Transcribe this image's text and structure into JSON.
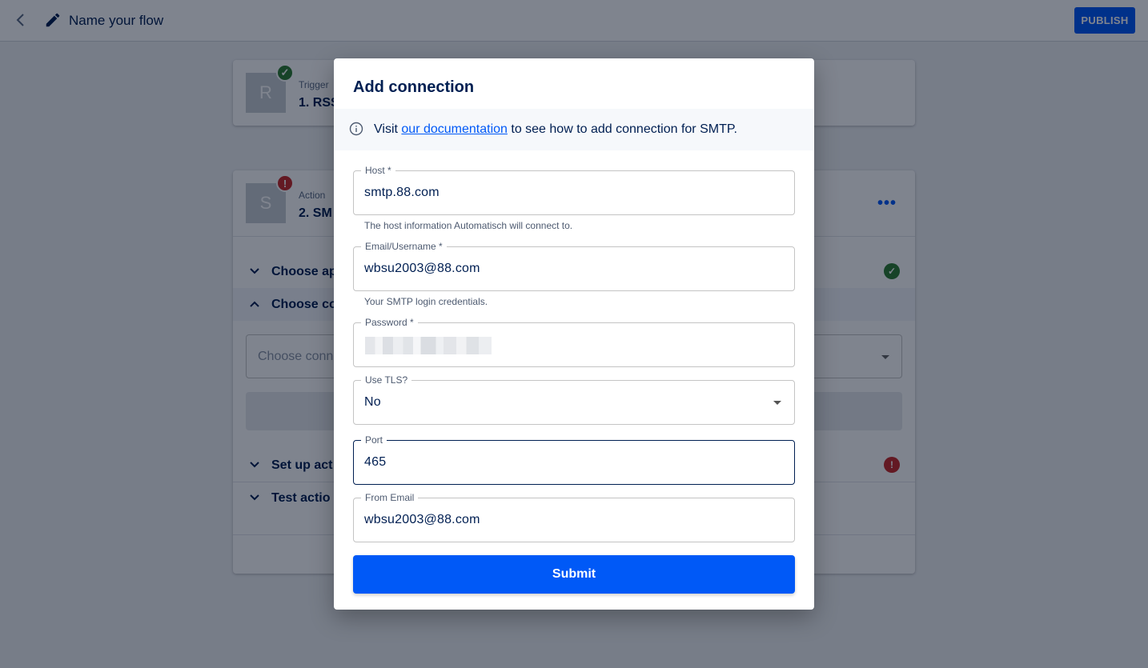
{
  "topbar": {
    "flow_name": "Name your flow",
    "publish_label": "PUBLISH"
  },
  "trigger_step": {
    "app_initial": "R",
    "type_label": "Trigger",
    "title": "1. RSS"
  },
  "action_step": {
    "app_initial": "S",
    "type_label": "Action",
    "title": "2. SM",
    "more": "•••",
    "sections": [
      {
        "label": "Choose ap"
      },
      {
        "label": "Choose co"
      },
      {
        "label": "Set up act"
      },
      {
        "label": "Test actio"
      }
    ],
    "connection_placeholder": "Choose conn"
  },
  "modal": {
    "title": "Add connection",
    "info": {
      "prefix": "Visit ",
      "link": "our documentation",
      "suffix": " to see how to add connection for SMTP."
    },
    "fields": {
      "host": {
        "label": "Host *",
        "value": "smtp.88.com",
        "helper": "The host information Automatisch will connect to."
      },
      "username": {
        "label": "Email/Username *",
        "value": "wbsu2003@88.com",
        "helper": "Your SMTP login credentials."
      },
      "password": {
        "label": "Password *"
      },
      "tls": {
        "label": "Use TLS?",
        "value": "No"
      },
      "port": {
        "label": "Port",
        "value": "465"
      },
      "from_email": {
        "label": "From Email",
        "value": "wbsu2003@88.com"
      }
    },
    "submit_label": "Submit"
  },
  "colors": {
    "primary": "#0059f7",
    "text": "#001f52",
    "success": "#2e7d32",
    "error": "#c62828"
  }
}
